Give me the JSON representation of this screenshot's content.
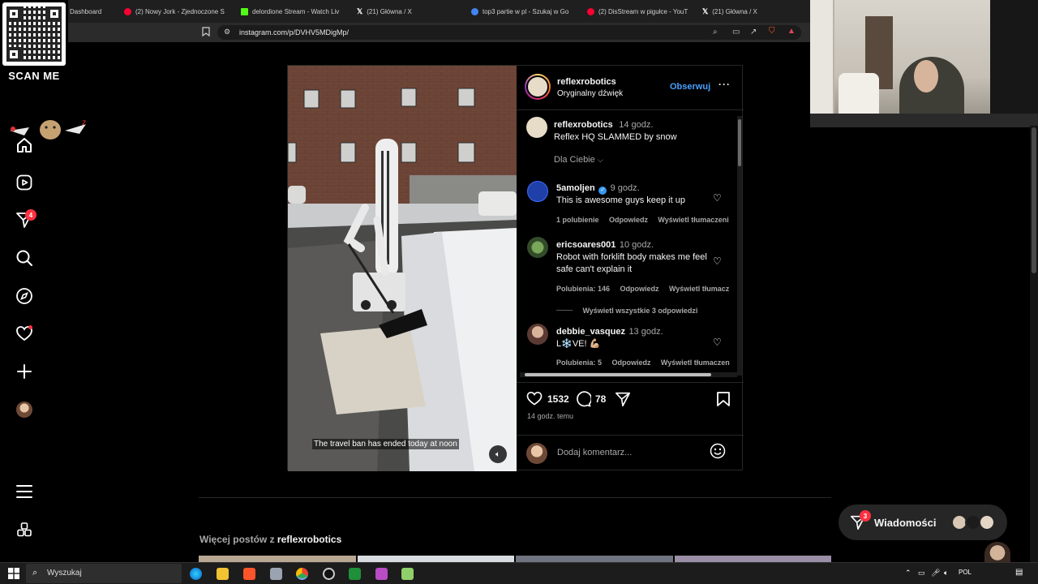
{
  "browser": {
    "tabs": [
      {
        "label": "Dashboard",
        "color": "#3b3b3b"
      },
      {
        "label": "(2) Nowy Jork - Zjednoczone S",
        "color": "#ff0033"
      },
      {
        "label": "delordione Stream - Watch Liv",
        "color": "#53fc18"
      },
      {
        "label": "(21) Główna / X",
        "color": "#ffffff"
      },
      {
        "label": "top3 partie w pl - Szukaj w Go",
        "color": "#4285f4"
      },
      {
        "label": "(2) DisStream w pigułce - YouT",
        "color": "#ff0033"
      },
      {
        "label": "(21) Główna / X",
        "color": "#ffffff"
      }
    ],
    "url": "instagram.com/p/DVHV5MDigMp/"
  },
  "overlay": {
    "scan_label": "SCAN ME"
  },
  "nav": {
    "notifications_badge": "4"
  },
  "post": {
    "author": "reflexrobotics",
    "audio": "Oryginalny dźwięk",
    "follow_label": "Obserwuj",
    "video_caption": "The travel ban has ended today at noon",
    "caption": {
      "user": "reflexrobotics",
      "time": "14 godz.",
      "text": "Reflex HQ SLAMMED by snow"
    },
    "filter_label": "Dla Ciebie",
    "comments": [
      {
        "user": "5amoljen",
        "verified": true,
        "time": "9 godz.",
        "text": "This is awesome guys keep it up",
        "likes": "1 polubienie",
        "reply": "Odpowiedz",
        "translate": "Wyświetl tłumaczeni"
      },
      {
        "user": "ericsoares001",
        "verified": false,
        "time": "10 godz.",
        "text": "Robot with forklift body makes me feel safe can't explain it",
        "likes": "Polubienia: 146",
        "reply": "Odpowiedz",
        "translate": "Wyświetl tłumacz"
      },
      {
        "user": "debbie_vasquez",
        "verified": false,
        "time": "13 godz.",
        "text": "L❄️VE! 💪🏼",
        "likes": "Polubienia: 5",
        "reply": "Odpowiedz",
        "translate": "Wyświetl tłumaczen"
      }
    ],
    "view_replies": "Wyświetl wszystkie 3 odpowiedzi",
    "like_count": "1532",
    "comment_count": "78",
    "posted_ago": "14 godz. temu",
    "add_comment_placeholder": "Dodaj komentarz..."
  },
  "more_posts": {
    "prefix": "Więcej postów z",
    "user": "reflexrobotics"
  },
  "messages": {
    "label": "Wiadomości",
    "badge": "3"
  },
  "taskbar": {
    "search_label": "Wyszukaj",
    "lang": "POL"
  }
}
